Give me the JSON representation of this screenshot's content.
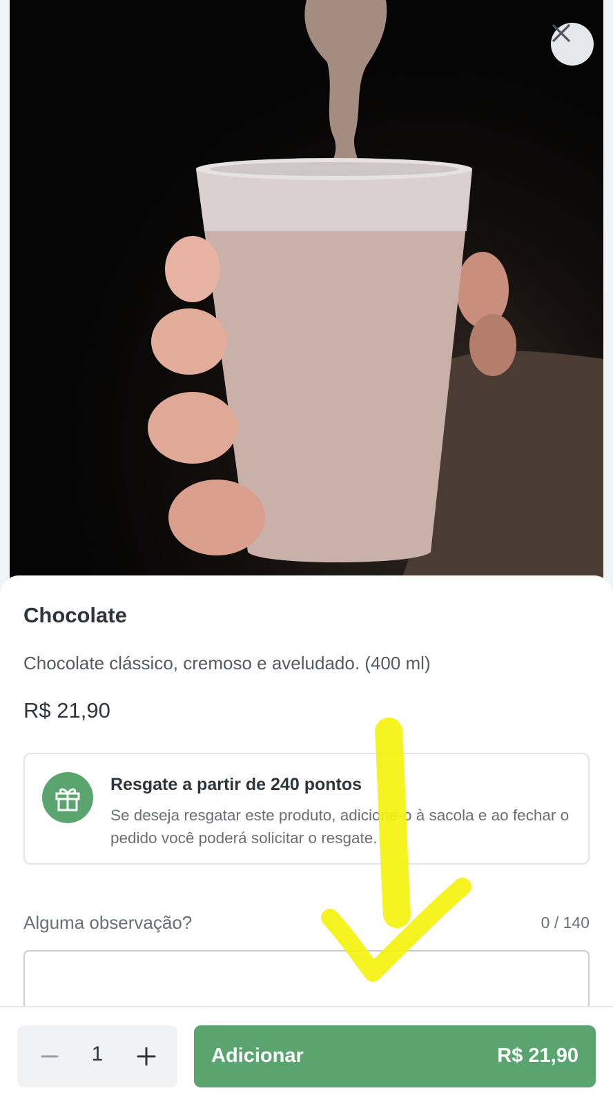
{
  "product": {
    "name": "Chocolate",
    "description": "Chocolate clássico, cremoso e aveludado. (400 ml)",
    "price": "R$ 21,90"
  },
  "reward": {
    "title": "Resgate a partir de 240 pontos",
    "text": "Se deseja resgatar este produto, adicione-o à sacola e ao fechar o pedido você poderá solicitar o resgate."
  },
  "observation": {
    "label": "Alguma observação?",
    "counter": "0 / 140",
    "value": ""
  },
  "footer": {
    "quantity": "1",
    "add_label": "Adicionar",
    "add_price": "R$ 21,90"
  },
  "colors": {
    "accent_green": "#5aa56f",
    "highlight_yellow": "#f5f20f"
  }
}
